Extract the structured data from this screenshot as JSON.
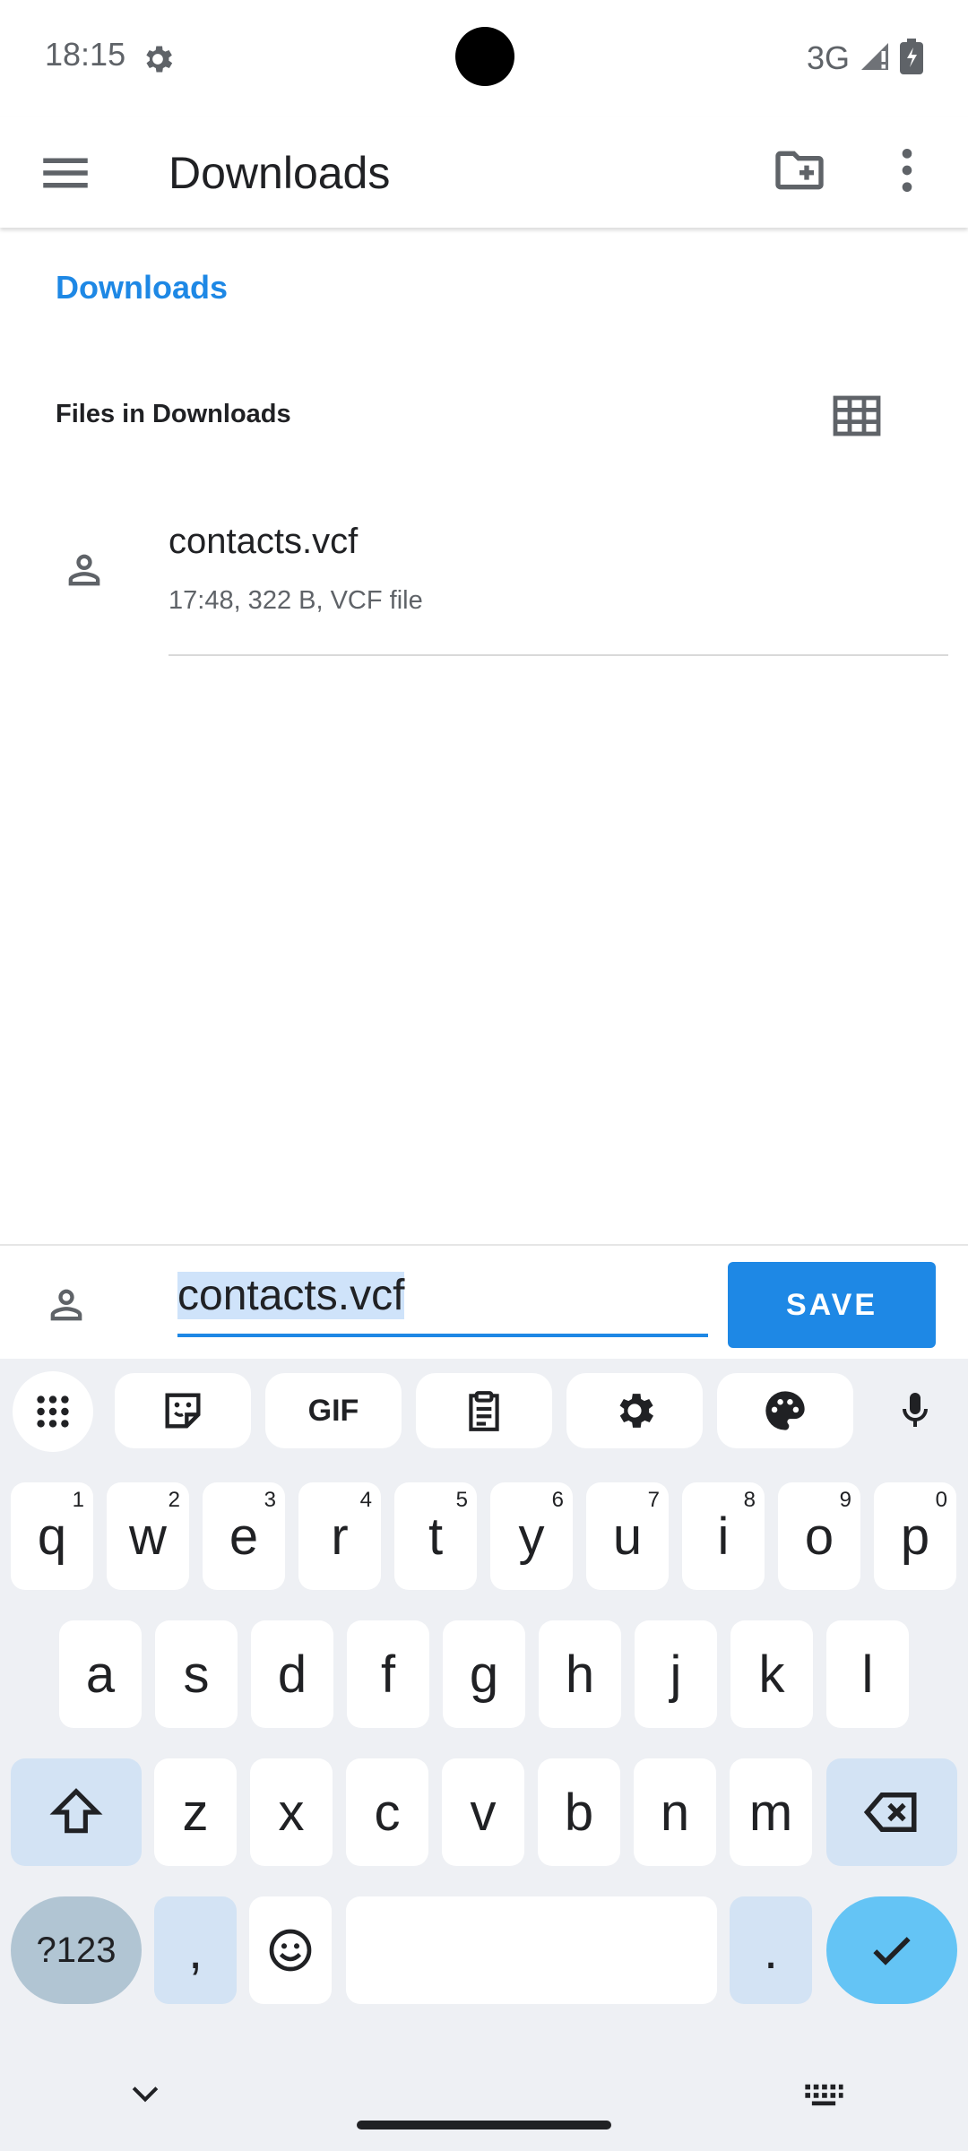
{
  "status_bar": {
    "time": "18:15",
    "network": "3G"
  },
  "app_bar": {
    "title": "Downloads"
  },
  "breadcrumb": {
    "label": "Downloads"
  },
  "section": {
    "header": "Files in Downloads"
  },
  "files": [
    {
      "name": "contacts.vcf",
      "meta": "17:48, 322 B, VCF file"
    }
  ],
  "save_bar": {
    "filename": "contacts.vcf",
    "save_label": "SAVE"
  },
  "keyboard": {
    "toolbar": [
      "apps-icon",
      "sticker-icon",
      "gif",
      "clipboard-icon",
      "settings-icon",
      "palette-icon",
      "mic-icon"
    ],
    "gif_label": "GIF",
    "row1": [
      "q",
      "w",
      "e",
      "r",
      "t",
      "y",
      "u",
      "i",
      "o",
      "p"
    ],
    "row1_hints": [
      "1",
      "2",
      "3",
      "4",
      "5",
      "6",
      "7",
      "8",
      "9",
      "0"
    ],
    "row2": [
      "a",
      "s",
      "d",
      "f",
      "g",
      "h",
      "j",
      "k",
      "l"
    ],
    "row3": [
      "z",
      "x",
      "c",
      "v",
      "b",
      "n",
      "m"
    ],
    "symbols_label": "?123",
    "comma_label": ",",
    "period_label": "."
  },
  "colors": {
    "accent": "#1e88e5",
    "keyboard_bg": "#eef0f4",
    "enter_key": "#64c4f5"
  }
}
